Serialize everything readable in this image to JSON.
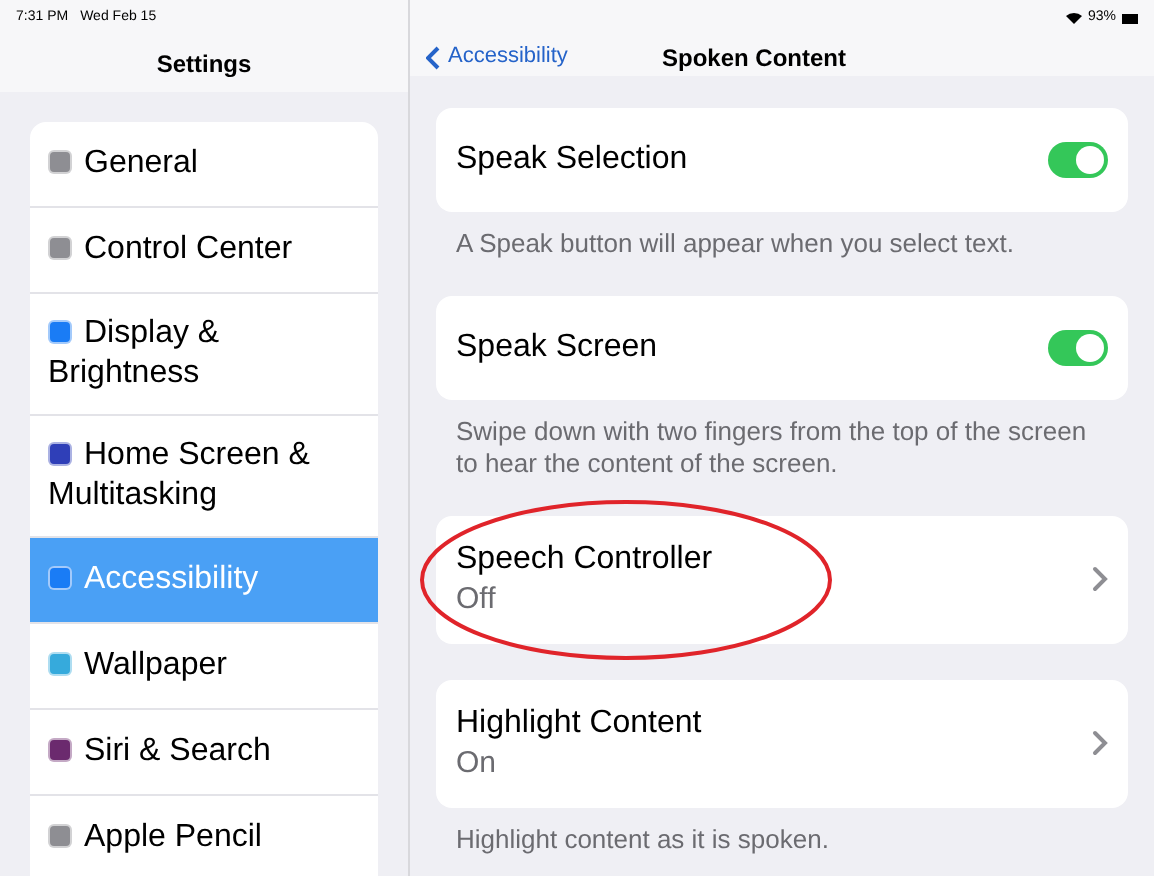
{
  "status_bar": {
    "time": "7:31 PM",
    "date": "Wed Feb 15",
    "battery": "93%"
  },
  "sidebar": {
    "title": "Settings",
    "items": [
      {
        "label": "General",
        "color": "#8e8e93",
        "selected": false
      },
      {
        "label": "Control Center",
        "color": "#8e8e93",
        "selected": false
      },
      {
        "label": "Display & Brightness",
        "color": "#1a7cf5",
        "selected": false
      },
      {
        "label": "Home Screen & Multitasking",
        "color": "#2f3fb8",
        "selected": false
      },
      {
        "label": "Accessibility",
        "color": "#1a7cf5",
        "selected": true
      },
      {
        "label": "Wallpaper",
        "color": "#36aadc",
        "selected": false
      },
      {
        "label": "Siri & Search",
        "color": "#6b2a6e",
        "selected": false
      },
      {
        "label": "Apple Pencil",
        "color": "#8e8e93",
        "selected": false
      }
    ]
  },
  "detail": {
    "back": "Accessibility",
    "title": "Spoken Content",
    "groups": [
      {
        "kind": "toggle",
        "label": "Speak Selection",
        "on": true,
        "footer": "A Speak button will appear when you select text.",
        "circled": false
      },
      {
        "kind": "toggle",
        "label": "Speak Screen",
        "on": true,
        "footer": "Swipe down with two fingers from the top of the screen to hear the content of the screen.",
        "circled": false
      },
      {
        "kind": "link",
        "label": "Speech Controller",
        "value": "Off",
        "circled": true
      },
      {
        "kind": "link",
        "label": "Highlight Content",
        "value": "On",
        "footer": "Highlight content as it is spoken.",
        "circled": false
      }
    ]
  }
}
